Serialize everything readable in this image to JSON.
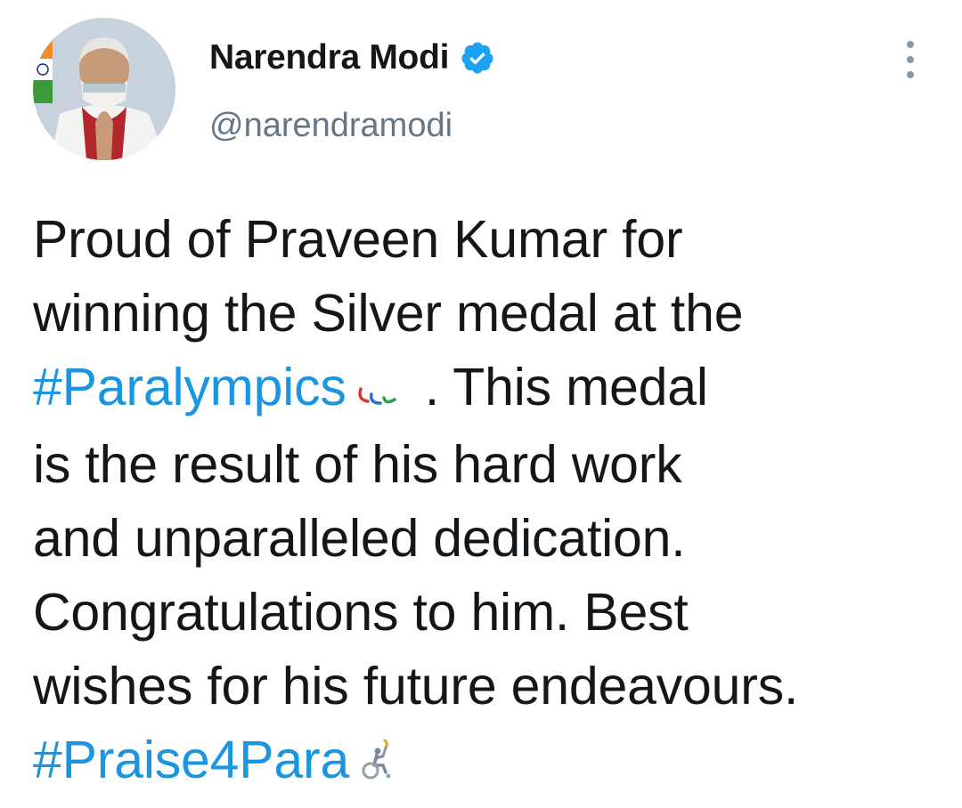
{
  "author": {
    "display_name": "Narendra Modi",
    "handle": "@narendramodi",
    "verified": true
  },
  "tweet": {
    "line1": "Proud of Praveen Kumar for",
    "line2": "winning the Silver medal at the",
    "hashtag1": "#Paralympics",
    "line3_rest": ". This medal",
    "line4": "is the result of his hard work",
    "line5": "and unparalleled dedication.",
    "line6": "Congratulations to him. Best",
    "line7": "wishes for his future endeavours.",
    "hashtag2": "#Praise4Para"
  },
  "icons": {
    "verified": "verified-badge-icon",
    "more": "more-options-icon",
    "paralympics": "paralympics-agitos-emoji",
    "wheelchair": "wheelchair-torch-emoji"
  },
  "colors": {
    "hashtag": "#1b95e0",
    "verified": "#1da1f2",
    "text": "#14171a",
    "secondary": "#657786"
  }
}
